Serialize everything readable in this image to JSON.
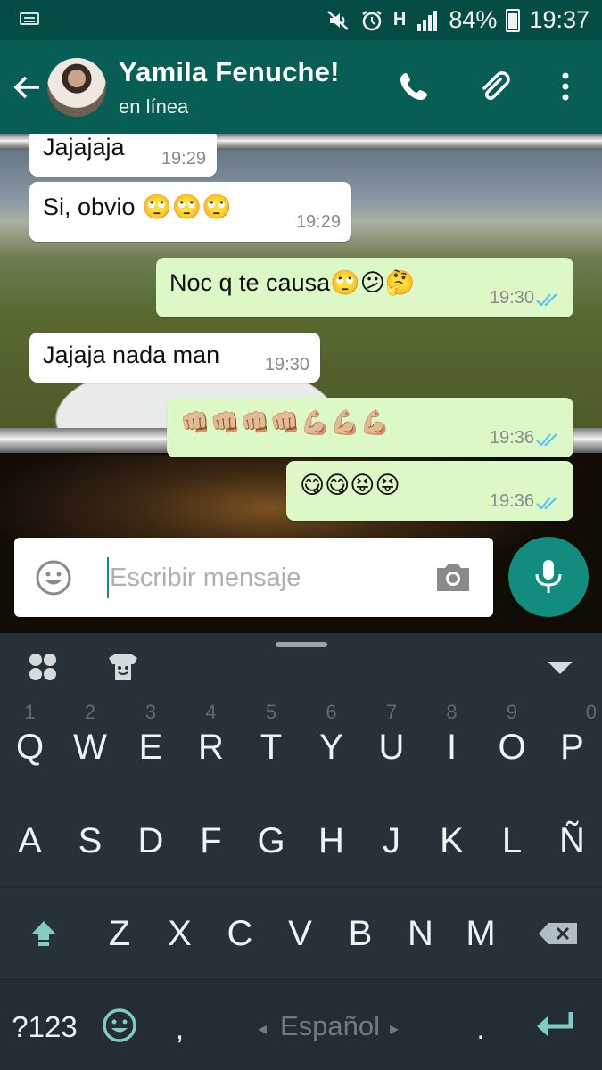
{
  "status_bar": {
    "battery_percent": "84%",
    "time": "19:37",
    "network": "H"
  },
  "header": {
    "contact_name": "Yamila Fenuche!",
    "contact_status": "en línea"
  },
  "messages": [
    {
      "direction": "in",
      "text": "Jajajaja",
      "time": "19:29"
    },
    {
      "direction": "in",
      "text": "Si, obvio 🙄🙄🙄",
      "time": "19:29"
    },
    {
      "direction": "out",
      "text": "Noc q te causa🙄😕🤔",
      "time": "19:30",
      "read": true
    },
    {
      "direction": "in",
      "text": "Jajaja nada man",
      "time": "19:30"
    },
    {
      "direction": "out",
      "text": "👊🏼👊🏼👊🏼👊🏼💪🏼💪🏼💪🏼",
      "time": "19:36",
      "read": true
    },
    {
      "direction": "out",
      "text": "😋😋😝😝",
      "time": "19:36",
      "read": true
    }
  ],
  "composer": {
    "placeholder": "Escribir mensaje"
  },
  "keyboard": {
    "row1_hints": [
      "1",
      "2",
      "3",
      "4",
      "5",
      "6",
      "7",
      "8",
      "9",
      "0"
    ],
    "row1": [
      "Q",
      "W",
      "E",
      "R",
      "T",
      "Y",
      "U",
      "I",
      "O",
      "P"
    ],
    "row2": [
      "A",
      "S",
      "D",
      "F",
      "G",
      "H",
      "J",
      "K",
      "L",
      "Ñ"
    ],
    "row3": [
      "Z",
      "X",
      "C",
      "V",
      "B",
      "N",
      "M"
    ],
    "symbols_label": "?123",
    "comma": ",",
    "period": ".",
    "language": "Español"
  },
  "colors": {
    "status_bar": "#054d44",
    "app_bar": "#075e54",
    "outgoing_bubble": "#dcf8c6",
    "incoming_bubble": "#ffffff",
    "accent": "#128c7e",
    "keyboard_bg": "#263238",
    "read_ticks": "#4fc3f7"
  }
}
